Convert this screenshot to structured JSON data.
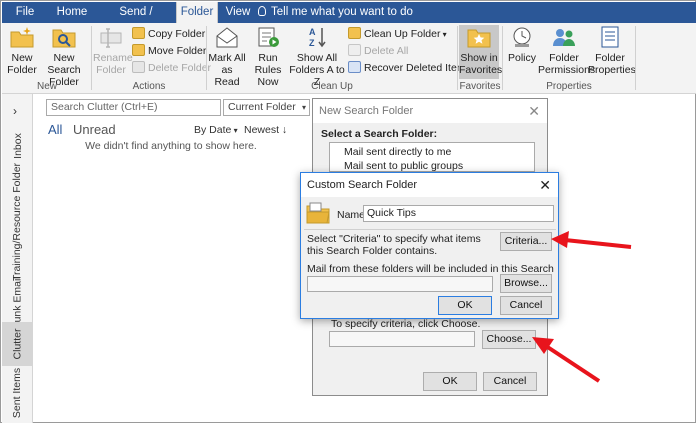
{
  "tabs": [
    {
      "label": "File",
      "active": false
    },
    {
      "label": "Home",
      "active": false
    },
    {
      "label": "Send / Receive",
      "active": false
    },
    {
      "label": "Folder",
      "active": true
    },
    {
      "label": "View",
      "active": false
    }
  ],
  "tell_me": "Tell me what you want to do",
  "ribbon": {
    "new_folder": "New\nFolder",
    "new_search_folder": "New Search\nFolder",
    "rename_folder": "Rename\nFolder",
    "copy_folder": "Copy Folder",
    "move_folder": "Move Folder",
    "delete_folder": "Delete Folder",
    "mark_all_as_read": "Mark All\nas Read",
    "run_rules_now": "Run Rules\nNow",
    "show_all_folders": "Show All\nFolders A to Z",
    "clean_up_folder": "Clean Up Folder",
    "delete_all": "Delete All",
    "recover_deleted_items": "Recover Deleted Items",
    "show_in_favorites": "Show in\nFavorites",
    "policy": "Policy",
    "folder_permissions": "Folder\nPermissions",
    "folder_properties": "Folder\nProperties",
    "groups": {
      "new": "New",
      "actions": "Actions",
      "clean_up": "Clean Up",
      "favorites": "Favorites",
      "properties": "Properties"
    }
  },
  "nav": {
    "chevron": "›",
    "items": [
      "Inbox",
      "Training/Resource Folder",
      "Junk Email",
      "Clutter",
      "Sent Items"
    ]
  },
  "list": {
    "search_placeholder": "Search Clutter (Ctrl+E)",
    "current_folder": "Current Folder",
    "filter_all": "All",
    "filter_unread": "Unread",
    "sort_by": "By Date",
    "sort_order": "Newest",
    "empty_message": "We didn't find anything to show here."
  },
  "new_search_folder_dialog": {
    "title": "New Search Folder",
    "select_label": "Select a Search Folder:",
    "options": [
      "Mail sent directly to me",
      "Mail sent to public groups"
    ],
    "criteria_hint": "To specify criteria, click Choose.",
    "choose_button": "Choose...",
    "ok_button": "OK",
    "cancel_button": "Cancel"
  },
  "custom_search_folder_dialog": {
    "title": "Custom Search Folder",
    "name_label": "Name:",
    "name_value": "Quick Tips",
    "criteria_text": "Select \"Criteria\" to specify what items this Search Folder contains.",
    "criteria_button": "Criteria...",
    "mail_from_text": "Mail from these folders will be included in this Search Folder:",
    "folders_value": "",
    "browse_button": "Browse...",
    "ok_button": "OK",
    "cancel_button": "Cancel"
  },
  "colors": {
    "brand": "#2b5797",
    "arrow": "#e8141c"
  }
}
